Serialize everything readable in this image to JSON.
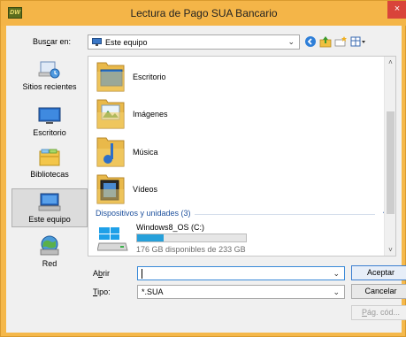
{
  "window": {
    "title": "Lectura de Pago SUA Bancario",
    "app_icon_text": "DW",
    "close_glyph": "×"
  },
  "lookin": {
    "label_pre": "Bus",
    "label_underlined": "c",
    "label_post": "ar en:",
    "value": "Este equipo",
    "arrow": "⌄"
  },
  "toolbar_icons": [
    "back-icon",
    "up-folder-icon",
    "new-folder-icon",
    "view-menu-icon"
  ],
  "places": [
    {
      "label": "Sitios recientes",
      "icon": "recent-places-icon",
      "selected": false
    },
    {
      "label": "Escritorio",
      "icon": "desktop-icon",
      "selected": false
    },
    {
      "label": "Bibliotecas",
      "icon": "libraries-icon",
      "selected": false
    },
    {
      "label": "Este equipo",
      "icon": "computer-icon",
      "selected": true
    },
    {
      "label": "Red",
      "icon": "network-icon",
      "selected": false
    }
  ],
  "files": [
    {
      "label": "Escritorio",
      "icon": "desktop-folder-icon"
    },
    {
      "label": "Imágenes",
      "icon": "pictures-folder-icon"
    },
    {
      "label": "Música",
      "icon": "music-folder-icon"
    },
    {
      "label": "Vídeos",
      "icon": "videos-folder-icon"
    }
  ],
  "drives_group": {
    "title": "Dispositivos y unidades (3)",
    "chevron": "˄"
  },
  "drive": {
    "name": "Windows8_OS (C:)",
    "space": "176 GB disponibles de 233 GB",
    "used_fraction": 0.245
  },
  "open_field": {
    "label_pre": "A",
    "label_underlined": "b",
    "label_post": "rir",
    "value": "",
    "arrow": "⌄"
  },
  "type_field": {
    "label_underlined": "T",
    "label_post": "ipo:",
    "value": "*.SUA",
    "arrow": "⌄"
  },
  "buttons": {
    "accept": "Aceptar",
    "cancel": "Cancelar",
    "codepage_pre": "",
    "codepage_underlined": "P",
    "codepage_post": "ág. cód..."
  },
  "scrollbar": {
    "up": "˄",
    "down": "˅"
  }
}
